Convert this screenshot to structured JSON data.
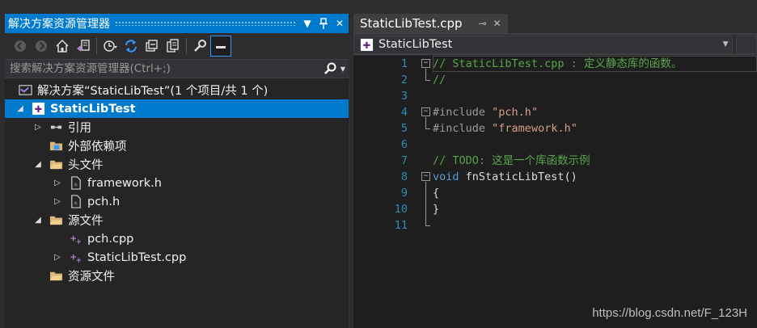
{
  "colors": {
    "accent": "#007acc",
    "comment": "#57a64a",
    "keyword": "#569cd6",
    "string": "#d69d85",
    "line_number": "#2b91af"
  },
  "solution_explorer": {
    "title": "解决方案资源管理器",
    "search": {
      "placeholder": "搜索解决方案资源管理器(Ctrl+;)"
    },
    "toolbar": [
      "back-icon",
      "forward-icon",
      "home-icon",
      "switch-views-icon",
      "pending-changes-icon",
      "sync-icon",
      "collapse-all-icon",
      "show-all-files-icon",
      "properties-icon",
      "preview-icon"
    ],
    "tree": [
      {
        "label": "解决方案“StaticLibTest”(1 个项目/共 1 个)",
        "icon": "solution-icon"
      },
      {
        "label": "StaticLibTest",
        "icon": "project-icon"
      },
      {
        "label": "引用",
        "icon": "references-icon"
      },
      {
        "label": "外部依赖项",
        "icon": "external-deps-icon"
      },
      {
        "label": "头文件",
        "icon": "folder-icon"
      },
      {
        "label": "framework.h",
        "icon": "header-file-icon"
      },
      {
        "label": "pch.h",
        "icon": "header-file-icon"
      },
      {
        "label": "源文件",
        "icon": "folder-icon"
      },
      {
        "label": "pch.cpp",
        "icon": "cpp-file-icon"
      },
      {
        "label": "StaticLibTest.cpp",
        "icon": "cpp-file-icon"
      },
      {
        "label": "资源文件",
        "icon": "folder-icon"
      }
    ]
  },
  "editor": {
    "tab": {
      "label": "StaticLibTest.cpp"
    },
    "nav": {
      "label": "StaticLibTest"
    },
    "lines": [
      {
        "n": "1",
        "comment": "// StaticLibTest.cpp : 定义静态库的函数。"
      },
      {
        "n": "2",
        "comment": "//"
      },
      {
        "n": "3"
      },
      {
        "n": "4",
        "directive": "#include",
        "string": "\"pch.h\""
      },
      {
        "n": "5",
        "directive": "#include",
        "string": "\"framework.h\""
      },
      {
        "n": "6"
      },
      {
        "n": "7",
        "comment": "// TODO: 这是一个库函数示例"
      },
      {
        "n": "8",
        "keyword": "void",
        "text": " fnStaticLibTest()"
      },
      {
        "n": "9",
        "text": "{"
      },
      {
        "n": "10",
        "text": "}"
      },
      {
        "n": "11"
      }
    ]
  },
  "watermark": "https://blog.csdn.net/F_123H"
}
